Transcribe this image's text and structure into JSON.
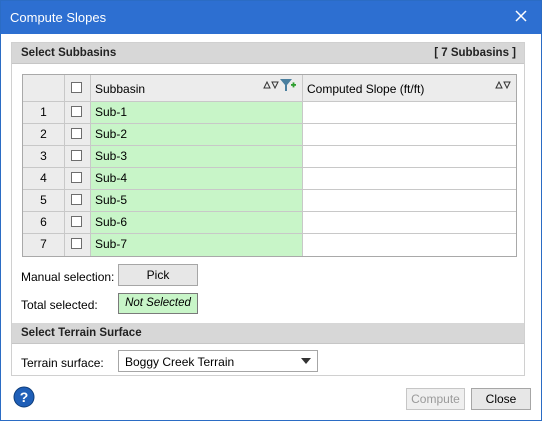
{
  "window": {
    "title": "Compute Slopes"
  },
  "subbasins": {
    "header": "Select Subbasins",
    "count_label": "[ 7 Subbasins ]",
    "columns": [
      "Subbasin",
      "Computed Slope (ft/ft)"
    ],
    "rows": [
      {
        "num": "1",
        "name": "Sub-1",
        "slope": ""
      },
      {
        "num": "2",
        "name": "Sub-2",
        "slope": ""
      },
      {
        "num": "3",
        "name": "Sub-3",
        "slope": ""
      },
      {
        "num": "4",
        "name": "Sub-4",
        "slope": ""
      },
      {
        "num": "5",
        "name": "Sub-5",
        "slope": ""
      },
      {
        "num": "6",
        "name": "Sub-6",
        "slope": ""
      },
      {
        "num": "7",
        "name": "Sub-7",
        "slope": ""
      }
    ],
    "manual_selection_label": "Manual selection:",
    "pick_label": "Pick",
    "total_selected_label": "Total selected:",
    "total_selected_value": "Not Selected"
  },
  "terrain": {
    "header": "Select Terrain Surface",
    "surface_label": "Terrain surface:",
    "surface_value": "Boggy Creek Terrain"
  },
  "footer": {
    "compute_label": "Compute",
    "close_label": "Close"
  },
  "colors": {
    "titlebar": "#2d6fd1",
    "selected_green": "#c8f5c8",
    "help": "#1f5fb8"
  }
}
